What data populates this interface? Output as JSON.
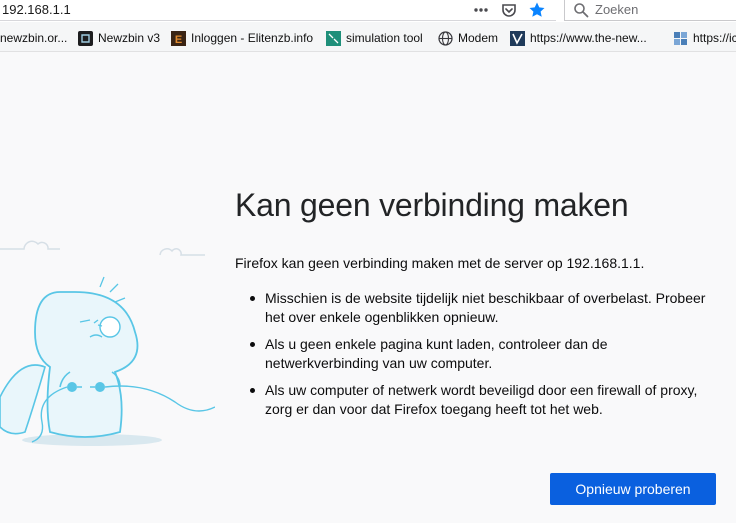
{
  "toolbar": {
    "url": "192.168.1.1",
    "search_placeholder": "Zoeken",
    "icons": [
      "page-actions-icon",
      "pocket-icon",
      "bookmark-star-icon",
      "search-icon"
    ]
  },
  "bookmarks": [
    {
      "label": "newzbin.or...",
      "icon": "none"
    },
    {
      "label": "Newzbin v3",
      "icon": "newzbin-icon"
    },
    {
      "label": "Inloggen - Elitenzb.info",
      "icon": "elitenzb-icon"
    },
    {
      "label": "simulation tool",
      "icon": "simulation-icon"
    },
    {
      "label": "Modem",
      "icon": "globe-icon"
    },
    {
      "label": "https://www.the-new...",
      "icon": "the-new-icon"
    },
    {
      "label": "https://ic",
      "icon": "site-icon"
    }
  ],
  "error": {
    "title": "Kan geen verbinding maken",
    "intro": "Firefox kan geen verbinding maken met de server op 192.168.1.1.",
    "reasons": [
      "Misschien is de website tijdelijk niet beschikbaar of overbelast. Probeer het over enkele ogenblikken opnieuw.",
      "Als u geen enkele pagina kunt laden, controleer dan de netwerkverbinding van uw computer.",
      "Als uw computer of netwerk wordt beveiligd door een firewall of proxy, zorg er dan voor dat Firefox toegang heeft tot het web."
    ],
    "retry_label": "Opnieuw proberen"
  },
  "colors": {
    "accent": "#0a60df",
    "star": "#0a84ff",
    "page_background": "#f9f9fa",
    "illustration_stroke": "#59c6e6"
  }
}
